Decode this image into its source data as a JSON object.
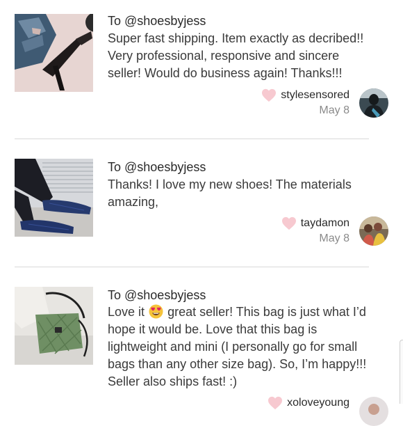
{
  "reviews": [
    {
      "to": "To @shoesbyjess",
      "lines": [
        "Super fast shipping. Item exactly as decribed!!",
        "Very professional, responsive and sincere",
        "seller! Would do business again! Thanks!!!"
      ],
      "username": "stylesensored",
      "date": "May 8",
      "thumb_icon": "heels-photo",
      "avatar_icon": "user-avatar"
    },
    {
      "to": "To @shoesbyjess",
      "lines": [
        "Thanks! I love my new shoes! The materials",
        "amazing,"
      ],
      "username": "taydamon",
      "date": "May 8",
      "thumb_icon": "loafers-photo",
      "avatar_icon": "user-avatar"
    },
    {
      "to": "To @shoesbyjess",
      "line1_before_emoji": "Love it",
      "emoji": "heart-eyes-emoji",
      "line1_after_emoji": "great seller! This bag is just what I’d",
      "lines": [
        "hope it would be. Love that this bag is",
        "lightweight and mini (I personally go for small",
        "bags than any other size bag). So, I’m happy!!!",
        "Seller also ships fast! :)"
      ],
      "username": "xoloveyoung",
      "thumb_icon": "green-quilted-bag-photo",
      "avatar_icon": "user-avatar"
    }
  ],
  "colors": {
    "heart": "#f7c9d0",
    "divider": "#d8d8d8",
    "date": "#8a8a8a",
    "text": "#3a3a3a"
  }
}
